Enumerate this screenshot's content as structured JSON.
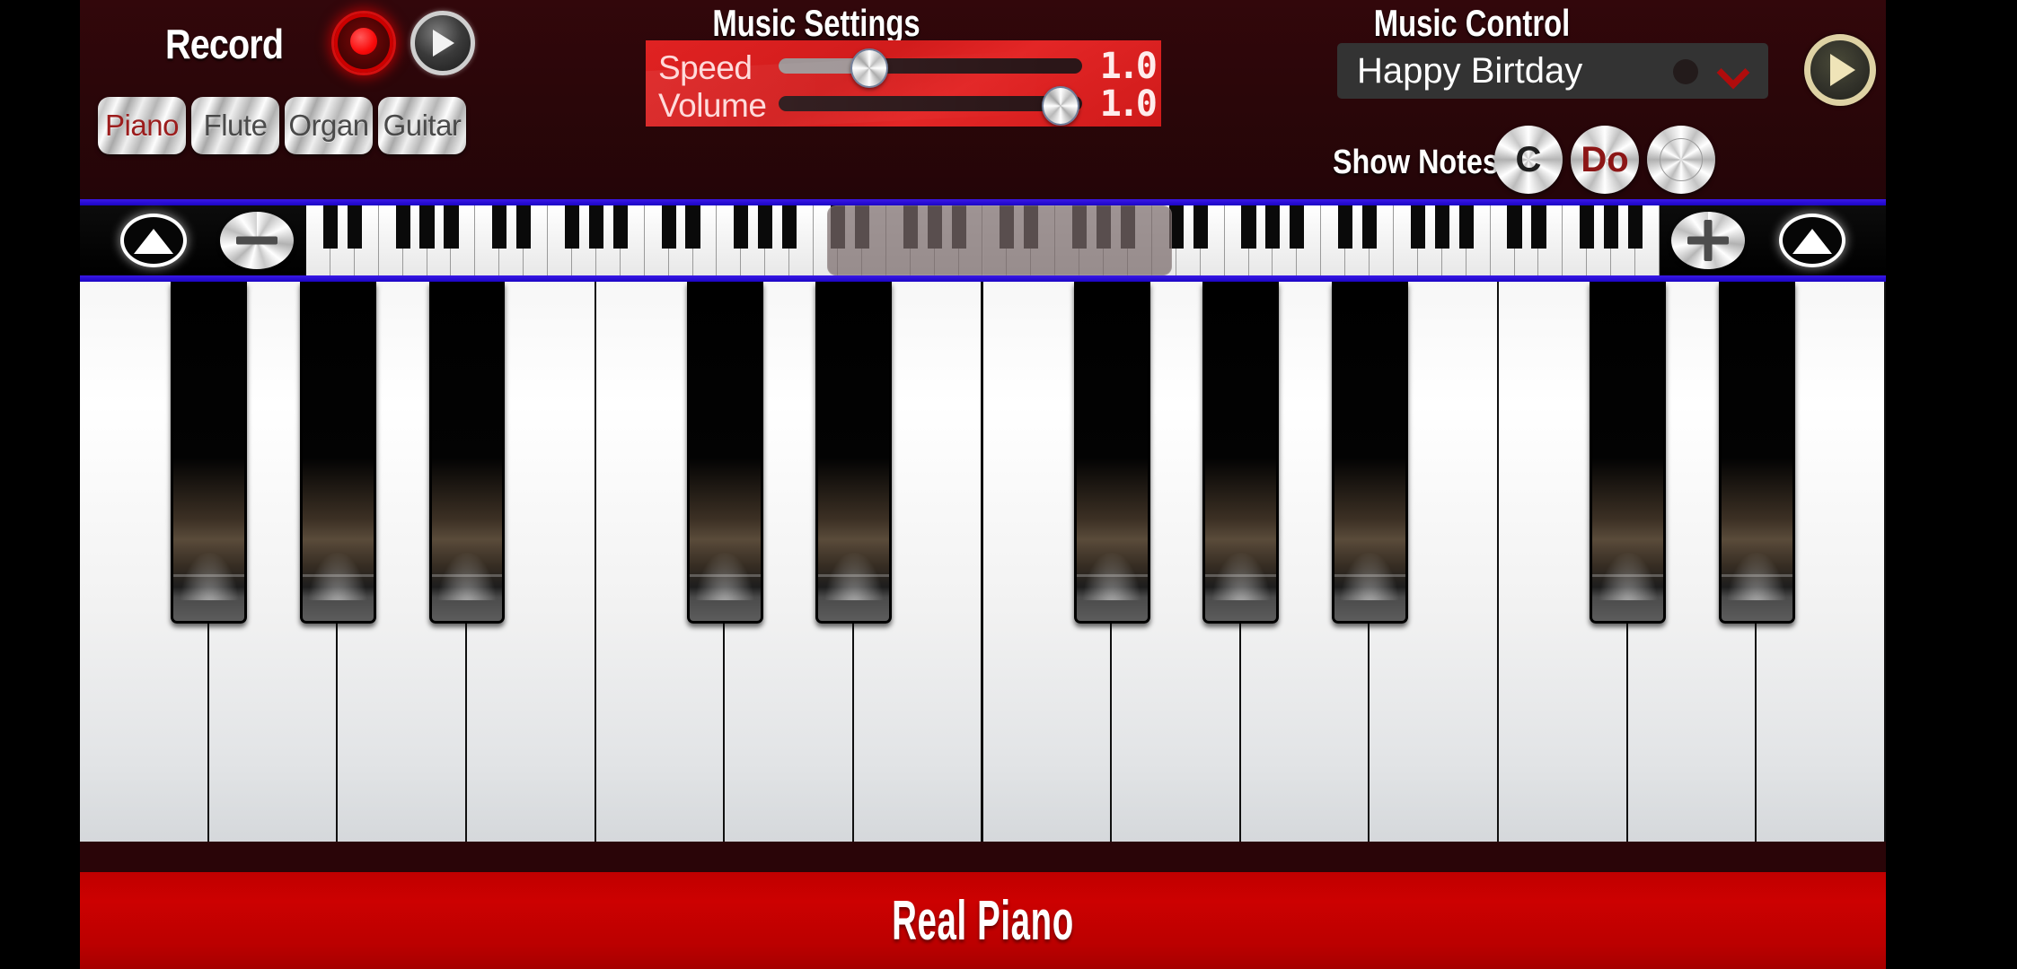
{
  "app": {
    "title": "Real Piano"
  },
  "record": {
    "label": "Record",
    "record_icon": "record-circle-icon",
    "play_icon": "play-triangle-icon"
  },
  "instruments": {
    "items": [
      {
        "label": "Piano",
        "selected": true
      },
      {
        "label": "Flute",
        "selected": false
      },
      {
        "label": "Organ",
        "selected": false
      },
      {
        "label": "Guitar",
        "selected": false
      }
    ],
    "selected_color": "#9c1d1d",
    "normal_color": "#4a4a4a"
  },
  "music_settings": {
    "title": "Music Settings",
    "panel_color": "#d11c1c",
    "speed": {
      "label": "Speed",
      "value": "1.0",
      "percent": 30
    },
    "volume": {
      "label": "Volume",
      "value": "1.0",
      "percent": 93
    }
  },
  "music_control": {
    "title": "Music Control",
    "song": "Happy Birtday",
    "chevron_icon": "chevron-down-icon",
    "play_icon": "play-triangle-icon",
    "show_notes_label": "Show Notes",
    "note_modes": [
      {
        "label": "C",
        "selected": false,
        "color": "#1e1e1e"
      },
      {
        "label": "Do",
        "selected": true,
        "color": "#8c1616"
      },
      {
        "label": "",
        "selected": false,
        "color": "#9a9a9a"
      }
    ]
  },
  "keyboard_strip": {
    "scroll_left_icon": "triangle-up-icon",
    "zoom_out_icon": "minus-icon",
    "zoom_in_icon": "plus-icon",
    "scroll_right_icon": "triangle-up-icon",
    "mini_keys_white": 56,
    "selection_start_pct": 38.5,
    "selection_width_pct": 25.5
  },
  "main_keyboard": {
    "white_keys": 14,
    "black_key_after_white_index": [
      0,
      1,
      2,
      4,
      5,
      7,
      8,
      9,
      11,
      12
    ],
    "white_key_color": "#f4f5f6",
    "black_key_color": "#000000"
  },
  "colors": {
    "background": "#2a0508",
    "accent_red": "#c00000",
    "blue_divider": "#2c0ed6",
    "letterbox": "#000000"
  }
}
